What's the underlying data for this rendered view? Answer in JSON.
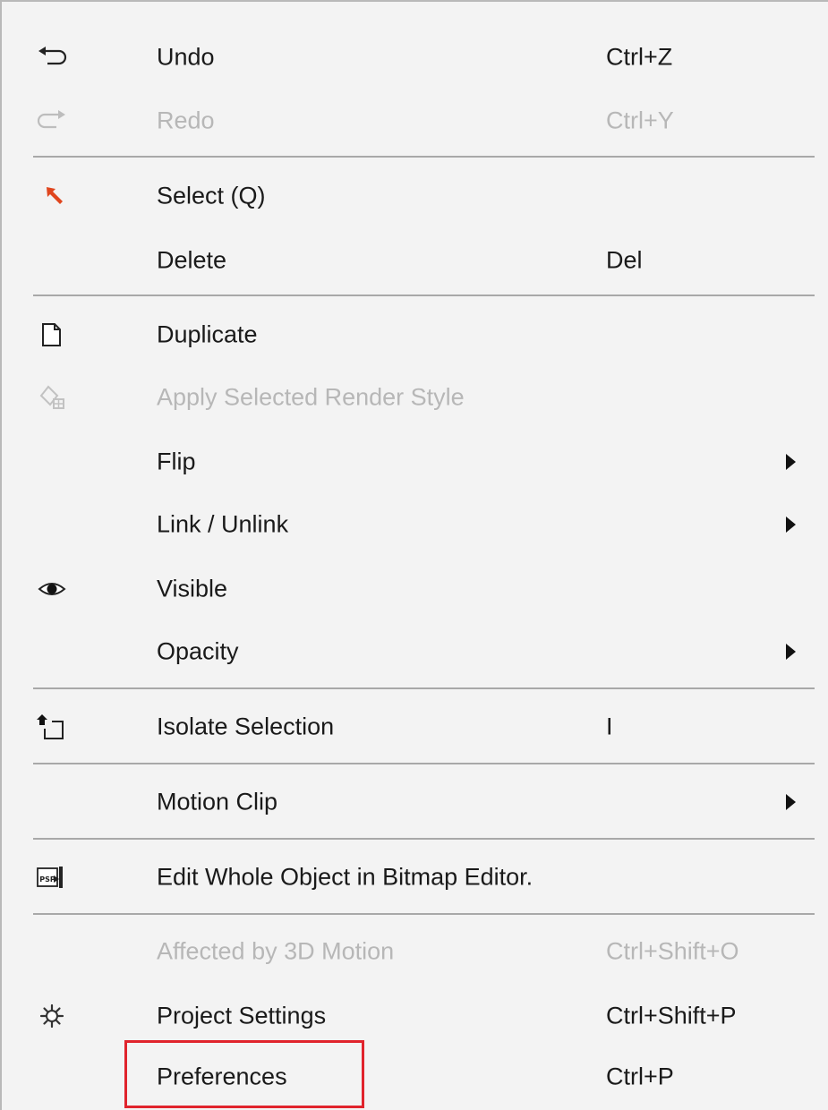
{
  "menu": {
    "items": [
      {
        "label": "Undo",
        "shortcut": "Ctrl+Z",
        "icon": "undo-icon",
        "enabled": true
      },
      {
        "label": "Redo",
        "shortcut": "Ctrl+Y",
        "icon": "redo-icon",
        "enabled": false
      },
      {
        "label": "Select (Q)",
        "shortcut": "",
        "icon": "select-arrow-icon",
        "enabled": true
      },
      {
        "label": "Delete",
        "shortcut": "Del",
        "icon": "",
        "enabled": true
      },
      {
        "label": "Duplicate",
        "shortcut": "",
        "icon": "duplicate-icon",
        "enabled": true
      },
      {
        "label": "Apply Selected Render Style",
        "shortcut": "",
        "icon": "render-style-icon",
        "enabled": false
      },
      {
        "label": "Flip",
        "shortcut": "",
        "icon": "",
        "enabled": true,
        "submenu": true
      },
      {
        "label": "Link / Unlink",
        "shortcut": "",
        "icon": "",
        "enabled": true,
        "submenu": true
      },
      {
        "label": "Visible",
        "shortcut": "",
        "icon": "eye-icon",
        "enabled": true
      },
      {
        "label": "Opacity",
        "shortcut": "",
        "icon": "",
        "enabled": true,
        "submenu": true
      },
      {
        "label": "Isolate Selection",
        "shortcut": "I",
        "icon": "isolate-selection-icon",
        "enabled": true
      },
      {
        "label": "Motion Clip",
        "shortcut": "",
        "icon": "",
        "enabled": true,
        "submenu": true
      },
      {
        "label": "Edit Whole Object in Bitmap Editor.",
        "shortcut": "",
        "icon": "bitmap-editor-icon",
        "enabled": true
      },
      {
        "label": "Affected by 3D Motion",
        "shortcut": "Ctrl+Shift+O",
        "icon": "",
        "enabled": false
      },
      {
        "label": "Project Settings",
        "shortcut": "Ctrl+Shift+P",
        "icon": "gear-icon",
        "enabled": true
      },
      {
        "label": "Preferences",
        "shortcut": "Ctrl+P",
        "icon": "",
        "enabled": true,
        "highlighted": true
      }
    ]
  },
  "colors": {
    "menu_background": "#f3f3f3",
    "text": "#1a1a1a",
    "disabled_text": "#b7b7b7",
    "separator": "#a8a8a8",
    "highlight_box": "#e0232c",
    "select_arrow": "#e0461e"
  }
}
